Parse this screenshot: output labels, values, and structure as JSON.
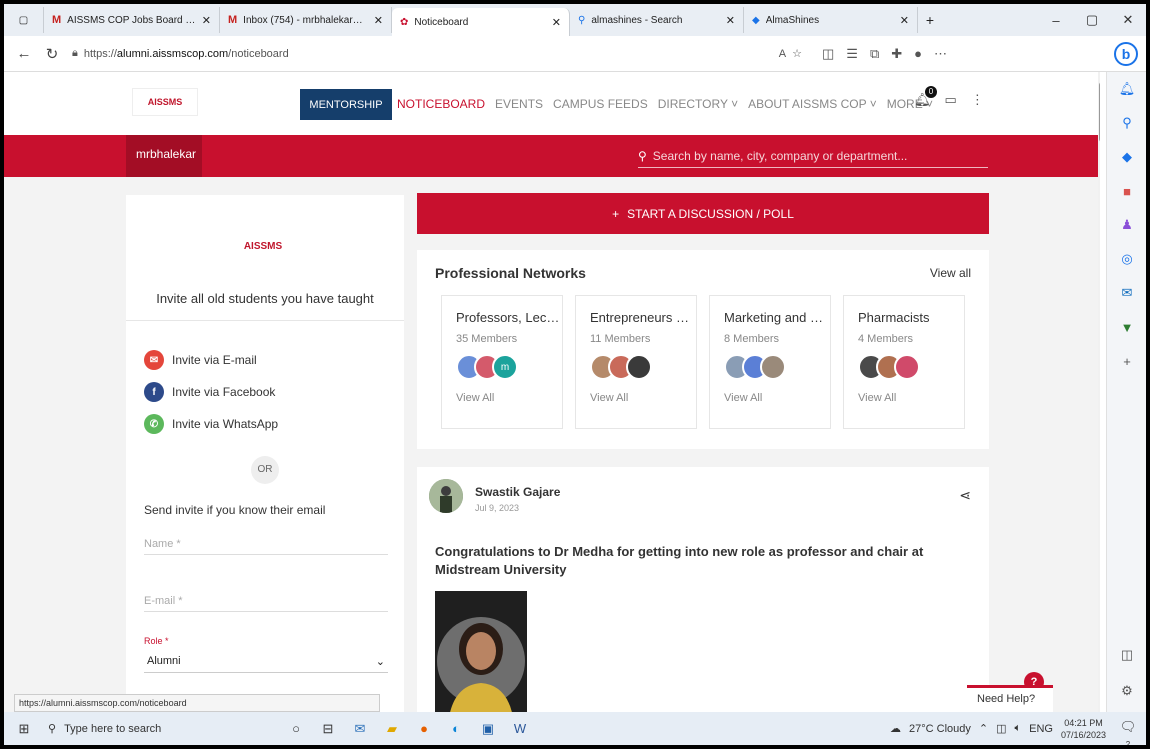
{
  "browser": {
    "tabs": [
      {
        "title": "AISSMS COP Jobs Board - mrbh",
        "icon": "gmail-icon"
      },
      {
        "title": "Inbox (754) - mrbhalekar@aissm",
        "icon": "gmail-icon"
      },
      {
        "title": "Noticeboard",
        "icon": "site-icon",
        "active": true
      },
      {
        "title": "almashines - Search",
        "icon": "search-icon"
      },
      {
        "title": "AlmaShines",
        "icon": "almashines-icon"
      }
    ],
    "new_tab": "+",
    "url_prefix": "https://",
    "url_host": "alumni.aissmscop.com",
    "url_path": "/noticeboard",
    "bing_label": "b"
  },
  "site": {
    "nav": {
      "mentorship": "MENTORSHIP",
      "noticeboard": "NOTICEBOARD",
      "events": "EVENTS",
      "campus_feeds": "CAMPUS FEEDS",
      "directory": "DIRECTORY ˅",
      "about": "ABOUT AISSMS COP ˅",
      "more": "MORE ˅"
    },
    "notification_count": "0",
    "logo_text": "AISSMS",
    "username": "mrbhalekar",
    "search_placeholder": "Search by name, city, company or department..."
  },
  "invite_card": {
    "logo_text": "AISSMS",
    "title": "Invite all old students you have taught",
    "email": "Invite via E-mail",
    "facebook": "Invite via Facebook",
    "whatsapp": "Invite via WhatsApp",
    "or": "OR",
    "send_label": "Send invite if you know their email",
    "name_placeholder": "Name *",
    "email_placeholder": "E-mail *",
    "role_label": "Role *",
    "role_value": "Alumni"
  },
  "start_discussion": "START A DISCUSSION / POLL",
  "networks": {
    "title": "Professional Networks",
    "view_all": "View all",
    "items": [
      {
        "name": "Professors, Lect...",
        "members": "35 Members",
        "view": "View All",
        "colors": [
          "#6a8fd8",
          "#d45a6b",
          "#1ba39c"
        ],
        "last_initial": "m"
      },
      {
        "name": "Entrepreneurs a...",
        "members": "11 Members",
        "view": "View All",
        "colors": [
          "#b58a6a",
          "#c96a5a",
          "#3a3a3a"
        ],
        "last_initial": ""
      },
      {
        "name": "Marketing and S...",
        "members": "8 Members",
        "view": "View All",
        "colors": [
          "#8a9db5",
          "#5b7fd6",
          "#9a8a7a"
        ],
        "last_initial": ""
      },
      {
        "name": "Pharmacists",
        "members": "4 Members",
        "view": "View All",
        "colors": [
          "#4a4a4a",
          "#b07050",
          "#d04a6a"
        ],
        "last_initial": ""
      }
    ]
  },
  "post": {
    "author": "Swastik Gajare",
    "date": "Jul 9, 2023",
    "text": "Congratulations to Dr Medha for getting into new role as professor and chair at Midstream University"
  },
  "help": {
    "label": "Need Help?",
    "q": "?"
  },
  "status_url": "https://alumni.aissmscop.com/noticeboard",
  "taskbar": {
    "search_placeholder": "Type here to search",
    "weather": "27°C Cloudy",
    "lang": "ENG",
    "time": "04:21 PM",
    "date": "07/16/2023",
    "notif_count": "2"
  },
  "colors": {
    "brand_red": "#c8102e",
    "nav_blue": "#153e6b"
  }
}
